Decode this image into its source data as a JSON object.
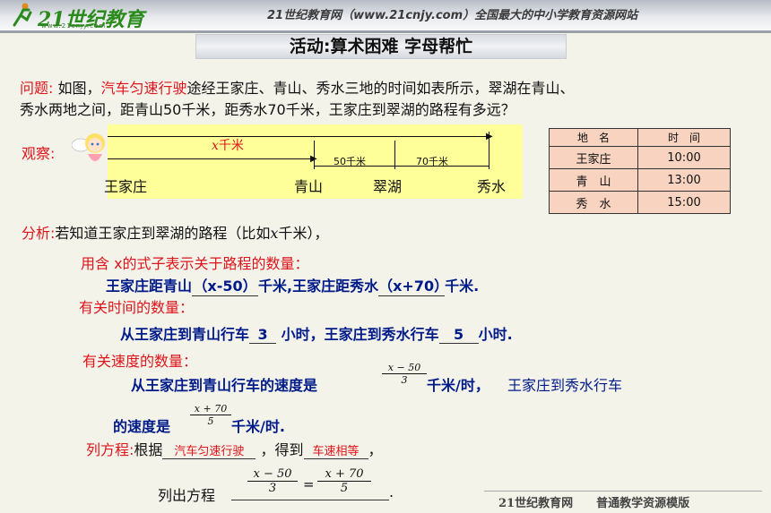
{
  "header": {
    "logo_text": "21世纪教育",
    "logo_subtext": "www.21cnjy.com",
    "slogan": "21世纪教育网（www.21cnjy.com）全国最大的中小学教育资源网站"
  },
  "title": "活动:算术困难   字母帮忙",
  "problem": {
    "label": "问题:",
    "text_a": "  如图，",
    "highlight": "汽车匀速行驶",
    "text_b": "途经王家庄、青山、秀水三地的时间如表所示，翠湖在青山、",
    "line2": "秀水两地之间，距青山50千米，距秀水70千米，王家庄到翠湖的路程有多远？"
  },
  "observe": {
    "label": "观察:",
    "x_label": "x",
    "x_unit": "千米",
    "seg1": "50千米",
    "seg2": "70千米",
    "places": [
      "王家庄",
      "青山",
      "翠湖",
      "秀水"
    ]
  },
  "table": {
    "headers": [
      "地　名",
      "时　间"
    ],
    "rows": [
      [
        "王家庄",
        "10:00"
      ],
      [
        "青　山",
        "13:00"
      ],
      [
        "秀　水",
        "15:00"
      ]
    ]
  },
  "analysis": {
    "label": "分析:",
    "text_a": "若知道王家庄到翠湖的路程（比如",
    "x": "x",
    "text_b": "千米），",
    "sub1": "用含 x的式子表示关于路程的数量：",
    "line1_a": "王家庄距青山",
    "blank1": "（x-50）",
    "line1_b": "千米,王家庄距秀水",
    "blank2": "（x+70）",
    "line1_c": "千米.",
    "sub2": "有关时间的数量：",
    "line2_a": "从王家庄到青山行车",
    "blank3": "3",
    "line2_b": " 小时，王家庄到秀水行车",
    "blank4": "5",
    "line2_c": "小时.",
    "sub3": "有关速度的数量：",
    "line3_a": "从王家庄到青山行车的速度是",
    "frac1_num": "x − 50",
    "frac1_den": "3",
    "line3_b": "千米/时，",
    "line3_c": "王家庄到秀水行车",
    "line4_a": "的速度是",
    "frac2_num": "x + 70",
    "frac2_den": "5",
    "line4_b": "千米/时."
  },
  "equation": {
    "label": "列方程:",
    "text_a": "根据",
    "blank1": "汽车匀速行驶",
    "text_b": " ，得到",
    "blank2": "车速相等",
    "text_c": "，",
    "line_label": "列出方程",
    "lhs_num": "x − 50",
    "lhs_den": "3",
    "eq": "=",
    "rhs_num": "x + 70",
    "rhs_den": "5",
    "end": "."
  },
  "footer": "21世纪教育网　　普通教学资源模版",
  "colors": {
    "accent_red": "#e0141a",
    "text_blue": "#001a8a",
    "diagram_bg": "#ffff99",
    "table_bg": "#f7d3c0"
  }
}
